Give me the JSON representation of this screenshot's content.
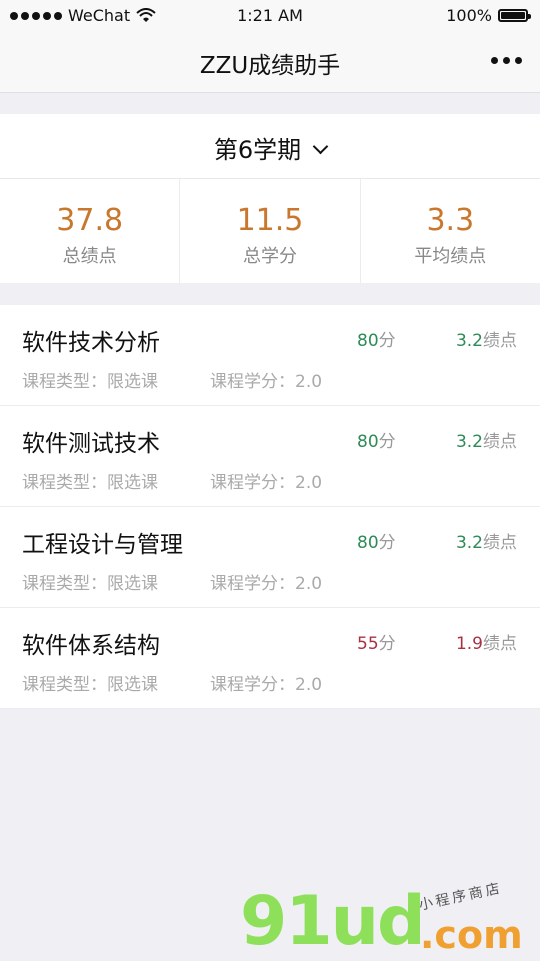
{
  "status_bar": {
    "carrier": "WeChat",
    "time": "1:21 AM",
    "battery": "100%"
  },
  "nav": {
    "title": "ZZU成绩助手"
  },
  "semester": {
    "label": "第6学期"
  },
  "stats": [
    {
      "value": "37.8",
      "label": "总绩点"
    },
    {
      "value": "11.5",
      "label": "总学分"
    },
    {
      "value": "3.3",
      "label": "平均绩点"
    }
  ],
  "courses": [
    {
      "name": "软件技术分析",
      "type": "课程类型：限选课",
      "credit": "课程学分：2.0",
      "score": "80",
      "score_unit": "分",
      "gpa": "3.2",
      "gpa_unit": "绩点"
    },
    {
      "name": "软件测试技术",
      "type": "课程类型：限选课",
      "credit": "课程学分：2.0",
      "score": "80",
      "score_unit": "分",
      "gpa": "3.2",
      "gpa_unit": "绩点"
    },
    {
      "name": "工程设计与管理",
      "type": "课程类型：限选课",
      "credit": "课程学分：2.0",
      "score": "80",
      "score_unit": "分",
      "gpa": "3.2",
      "gpa_unit": "绩点"
    },
    {
      "name": "软件体系结构",
      "type": "课程类型：限选课",
      "credit": "课程学分：2.0",
      "score": "55",
      "score_unit": "分",
      "gpa": "1.9",
      "gpa_unit": "绩点"
    }
  ],
  "watermark": {
    "main": "91ud",
    "domain": ".com",
    "tagline": "小程序商店"
  },
  "colors": {
    "stat_value": "#c8772c",
    "good": "#2e8b57",
    "bad": "#a83244"
  }
}
